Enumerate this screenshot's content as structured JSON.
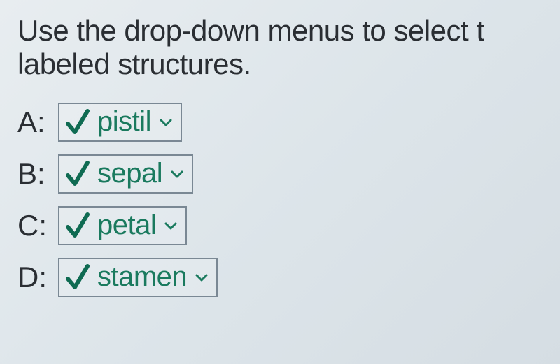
{
  "instruction": "Use the drop-down menus to select t\nlabeled structures.",
  "rows": [
    {
      "label": "A:",
      "value": "pistil"
    },
    {
      "label": "B:",
      "value": "sepal"
    },
    {
      "label": "C:",
      "value": "petal"
    },
    {
      "label": "D:",
      "value": "stamen"
    }
  ],
  "colors": {
    "text": "#2a2e33",
    "dropdown_text": "#1a7a5e",
    "check_stroke": "#0f6b52",
    "border": "#7a8894"
  }
}
